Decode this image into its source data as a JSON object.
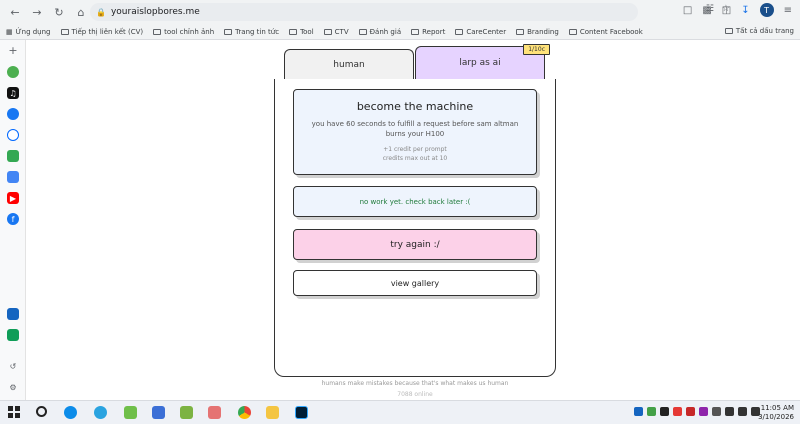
{
  "browser": {
    "url": "youraislopbores.me",
    "bookmarks": [
      {
        "label": "Ứng dụng"
      },
      {
        "label": "Tiếp thị liên kết (CV)"
      },
      {
        "label": "tool chỉnh ảnh"
      },
      {
        "label": "Trang tin tức"
      },
      {
        "label": "Tool"
      },
      {
        "label": "CTV"
      },
      {
        "label": "Đánh giá"
      },
      {
        "label": "Report"
      },
      {
        "label": "CareCenter"
      },
      {
        "label": "Branding"
      },
      {
        "label": "Content Facebook"
      }
    ],
    "all_bookmarks": "Tất cả dấu trang",
    "avatar_letter": "T"
  },
  "tabs": {
    "human": "human",
    "larp": "larp as ai",
    "badge": "1/10c"
  },
  "machine_card": {
    "title": "become the machine",
    "desc": "you have 60 seconds to fulfill a request before sam altman burns your H100",
    "credit_line1": "+1 credit per prompt",
    "credit_line2": "credits max out at 10"
  },
  "status": {
    "no_work": "no work yet. check back later :("
  },
  "buttons": {
    "try_again": "try again :/",
    "view_gallery": "view gallery"
  },
  "footer": {
    "tagline": "humans make mistakes because that's what makes us human",
    "online": "7088 online"
  },
  "taskbar": {
    "time": "11:05 AM",
    "date": "3/10/2026"
  },
  "colors": {
    "tab_active": "#e6d3ff",
    "try_again_bg": "#fcd1e8",
    "card_bg": "#eef4fd",
    "badge_bg": "#ffe27a",
    "status_text": "#1f7a3a"
  }
}
